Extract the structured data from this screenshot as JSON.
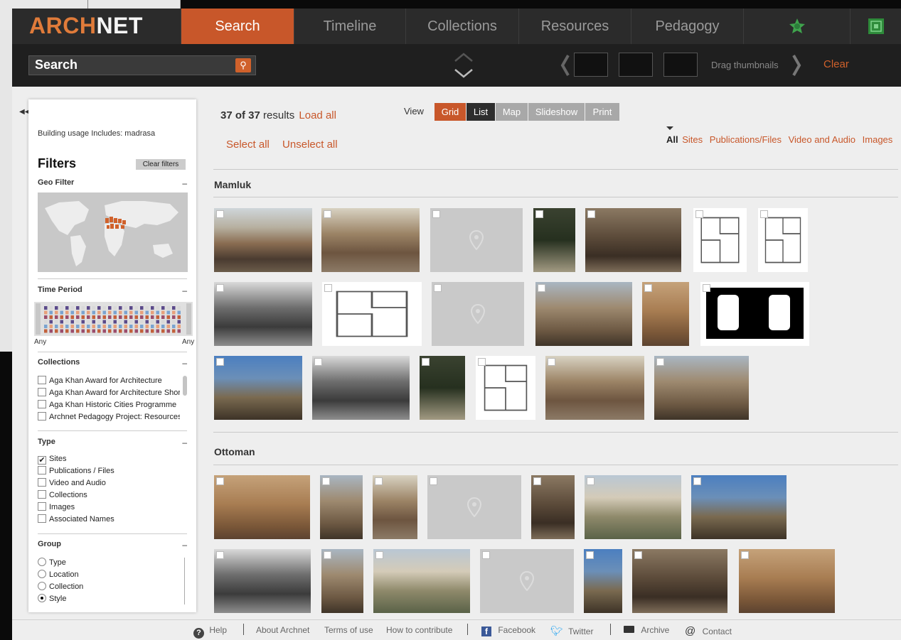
{
  "brand": {
    "logo_part1": "ARCH",
    "logo_part2": "NET",
    "accent": "#c8572a"
  },
  "nav": {
    "tabs": [
      {
        "label": "Search",
        "active": true
      },
      {
        "label": "Timeline"
      },
      {
        "label": "Collections"
      },
      {
        "label": "Resources"
      },
      {
        "label": "Pedagogy"
      }
    ]
  },
  "searchbar": {
    "placeholder": "Search",
    "drag_label": "Drag thumbnails",
    "clear_label": "Clear"
  },
  "sidebar": {
    "usage_text": "Building usage Includes: madrasa",
    "filters_title": "Filters",
    "clear_filters_label": "Clear filters",
    "geo_filter": "Geo Filter",
    "time_period": "Time Period",
    "time_any_left": "Any",
    "time_any_right": "Any",
    "collections_title": "Collections",
    "collections": [
      "Aga Khan Award for Architecture",
      "Aga Khan Award for Architecture Shortli",
      "Aga Khan Historic Cities Programme",
      "Archnet Pedagogy Project: Resources fo"
    ],
    "type_title": "Type",
    "types": [
      {
        "label": "Sites",
        "checked": true
      },
      {
        "label": "Publications / Files",
        "checked": false
      },
      {
        "label": "Video and Audio",
        "checked": false
      },
      {
        "label": "Collections",
        "checked": false
      },
      {
        "label": "Images",
        "checked": false
      },
      {
        "label": "Associated Names",
        "checked": false
      }
    ],
    "group_title": "Group",
    "groups": [
      {
        "label": "Type",
        "selected": false
      },
      {
        "label": "Location",
        "selected": false
      },
      {
        "label": "Collection",
        "selected": false
      },
      {
        "label": "Style",
        "selected": true
      }
    ]
  },
  "results": {
    "count_text": "37 of 37",
    "results_word": " results",
    "load_all": "Load all",
    "select_all": "Select all",
    "unselect_all": "Unselect all",
    "view_label": "View",
    "view_buttons": [
      {
        "label": "Grid",
        "active": true
      },
      {
        "label": "List"
      },
      {
        "label": "Map"
      },
      {
        "label": "Slideshow"
      },
      {
        "label": "Print"
      }
    ],
    "filter_all": "All",
    "filter_links": [
      "Sites",
      "Publications/Files",
      "Video and Audio",
      "Images"
    ],
    "groups": [
      {
        "title": "Mamluk"
      },
      {
        "title": "Ottoman"
      }
    ]
  },
  "footer": {
    "help": "Help",
    "about": "About Archnet",
    "terms": "Terms of use",
    "contribute": "How to contribute",
    "facebook": "Facebook",
    "twitter": "Twitter",
    "archive": "Archive",
    "contact": "Contact"
  }
}
